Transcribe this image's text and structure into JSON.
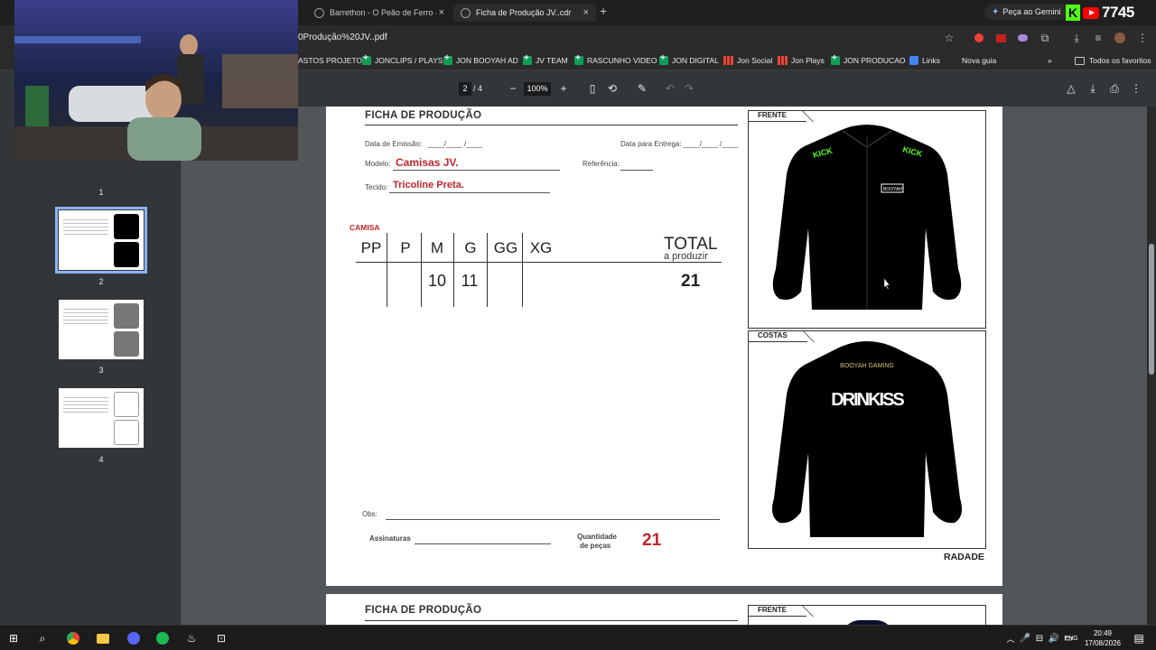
{
  "browser": {
    "tabs": [
      {
        "title": "Barrethon - O Peão de Ferro - Jo",
        "active": false
      },
      {
        "title": "Ficha de Produção JV..cdr",
        "active": true
      }
    ],
    "gemini_label": "Peça ao Gemini",
    "viewer_count": "7745",
    "url": "0Produção%20JV..pdf",
    "bookmarks": [
      {
        "label": "ASTOS PROJETO",
        "icon": "none"
      },
      {
        "label": "JONCLIPS / PLAYS",
        "icon": "sheets-icon"
      },
      {
        "label": "JON BOOYAH AD",
        "icon": "sheets-icon"
      },
      {
        "label": "JV TEAM",
        "icon": "sheets-icon"
      },
      {
        "label": "RASCUNHO VIDEO",
        "icon": "sheets-icon"
      },
      {
        "label": "JON DIGITAL",
        "icon": "sheets-icon"
      },
      {
        "label": "Jon Social",
        "icon": "chart-icon"
      },
      {
        "label": "Jon Plays",
        "icon": "chart-icon"
      },
      {
        "label": "JON PRODUCAO",
        "icon": "sheets-icon"
      },
      {
        "label": "Links",
        "icon": "link-icon"
      },
      {
        "label": "Nova guia",
        "icon": "none"
      }
    ],
    "all_bookmarks": "Todos os favoritos"
  },
  "pdf": {
    "current_page": "2",
    "page_total": "/ 4",
    "zoom": "100%",
    "thumbnails": [
      {
        "num": "1",
        "shirt_color": "#888"
      },
      {
        "num": "2",
        "shirt_color": "#000"
      },
      {
        "num": "3",
        "shirt_color": "#777"
      },
      {
        "num": "4",
        "shirt_color": "#ddd"
      }
    ]
  },
  "ficha": {
    "title": "FICHA DE PRODUÇÃO",
    "emissao_label": "Data de Emissão:",
    "emissao_value": "____/____ /____",
    "entrega_label": "Data para Entrega:",
    "entrega_value": "____/____ /____",
    "modelo_label": "Modelo:",
    "modelo_value": "Camisas JV.",
    "referencia_label": "Referência:",
    "tecido_label": "Tecido:",
    "tecido_value": "Tricoline Preta.",
    "category": "CAMISA",
    "sizes": [
      "PP",
      "P",
      "M",
      "G",
      "GG",
      "XG"
    ],
    "quantities": [
      "",
      "",
      "10",
      "11",
      "",
      ""
    ],
    "total_label": "TOTAL",
    "total_sub": "a produzir",
    "total_value": "21",
    "obs_label": "Obs:",
    "assinaturas_label": "Assinaturas",
    "quantidade_label_1": "Quantidade",
    "quantidade_label_2": "de peças",
    "quantidade_value": "21",
    "frente_label": "FRENTE",
    "costas_label": "COSTAS",
    "front_logo_left": "KICK",
    "front_logo_right": "KICK",
    "front_chest_logo": "BOOYAH",
    "back_top_logo": "BOOYAH GAMING",
    "back_main_text": "DRINKISS",
    "footer_text": "RADADE"
  },
  "next_page": {
    "title": "FICHA DE PRODUÇÃO",
    "frente_label": "FRENTE"
  },
  "taskbar": {
    "lang": "ENG",
    "time": "20:49",
    "date": "17/08/2026"
  }
}
